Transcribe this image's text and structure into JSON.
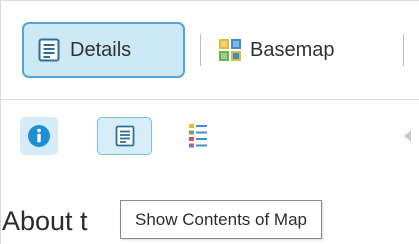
{
  "toolbar": {
    "tabs": [
      {
        "label": "Details",
        "icon": "details-doc-icon",
        "selected": true
      },
      {
        "label": "Basemap",
        "icon": "basemap-grid-icon",
        "selected": false
      }
    ]
  },
  "panel_buttons": [
    {
      "icon": "info-icon",
      "selected": false
    },
    {
      "icon": "contents-doc-icon",
      "selected": true
    },
    {
      "icon": "legend-list-icon",
      "selected": false
    }
  ],
  "content": {
    "heading_visible": "About t"
  },
  "tooltip": {
    "text": "Show Contents of Map"
  },
  "colors": {
    "selected_bg": "#cde9f6",
    "selected_border": "#52a6d6",
    "info_blue": "#1f8fd3",
    "basemap_yellow": "#e0b93d",
    "basemap_blue": "#3e8fc9",
    "basemap_green": "#6cae57"
  }
}
